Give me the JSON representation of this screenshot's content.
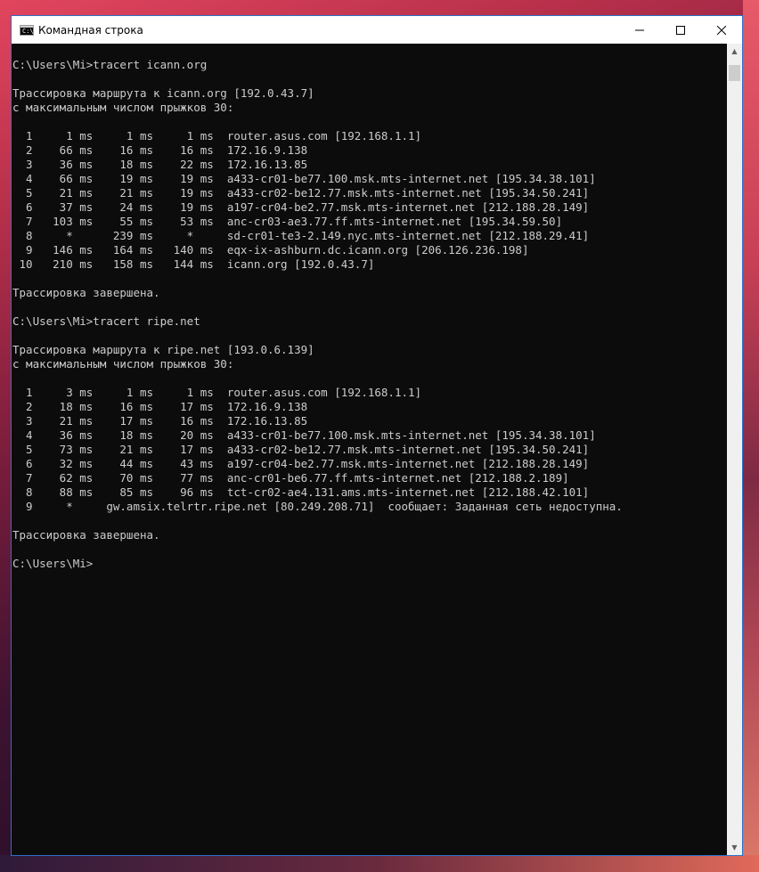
{
  "window": {
    "title": "Командная строка",
    "app_icon_glyph": "C:\\",
    "controls": {
      "minimize_icon": "minimize-icon",
      "maximize_icon": "maximize-icon",
      "close_icon": "close-icon"
    }
  },
  "terminal": {
    "lines": [
      "",
      "C:\\Users\\Mi>tracert icann.org",
      "",
      "Трассировка маршрута к icann.org [192.0.43.7]",
      "с максимальным числом прыжков 30:",
      "",
      "  1     1 ms     1 ms     1 ms  router.asus.com [192.168.1.1]",
      "  2    66 ms    16 ms    16 ms  172.16.9.138",
      "  3    36 ms    18 ms    22 ms  172.16.13.85",
      "  4    66 ms    19 ms    19 ms  a433-cr01-be77.100.msk.mts-internet.net [195.34.38.101]",
      "  5    21 ms    21 ms    19 ms  a433-cr02-be12.77.msk.mts-internet.net [195.34.50.241]",
      "  6    37 ms    24 ms    19 ms  a197-cr04-be2.77.msk.mts-internet.net [212.188.28.149]",
      "  7   103 ms    55 ms    53 ms  anc-cr03-ae3.77.ff.mts-internet.net [195.34.59.50]",
      "  8     *      239 ms     *     sd-cr01-te3-2.149.nyc.mts-internet.net [212.188.29.41]",
      "  9   146 ms   164 ms   140 ms  eqx-ix-ashburn.dc.icann.org [206.126.236.198]",
      " 10   210 ms   158 ms   144 ms  icann.org [192.0.43.7]",
      "",
      "Трассировка завершена.",
      "",
      "C:\\Users\\Mi>tracert ripe.net",
      "",
      "Трассировка маршрута к ripe.net [193.0.6.139]",
      "с максимальным числом прыжков 30:",
      "",
      "  1     3 ms     1 ms     1 ms  router.asus.com [192.168.1.1]",
      "  2    18 ms    16 ms    17 ms  172.16.9.138",
      "  3    21 ms    17 ms    16 ms  172.16.13.85",
      "  4    36 ms    18 ms    20 ms  a433-cr01-be77.100.msk.mts-internet.net [195.34.38.101]",
      "  5    73 ms    21 ms    17 ms  a433-cr02-be12.77.msk.mts-internet.net [195.34.50.241]",
      "  6    32 ms    44 ms    43 ms  a197-cr04-be2.77.msk.mts-internet.net [212.188.28.149]",
      "  7    62 ms    70 ms    77 ms  anc-cr01-be6.77.ff.mts-internet.net [212.188.2.189]",
      "  8    88 ms    85 ms    96 ms  tct-cr02-ae4.131.ams.mts-internet.net [212.188.42.101]",
      "  9     *     gw.amsix.telrtr.ripe.net [80.249.208.71]  сообщает: Заданная сеть недоступна.",
      "",
      "Трассировка завершена.",
      "",
      "C:\\Users\\Mi>"
    ]
  },
  "colors": {
    "terminal_bg": "#0c0c0c",
    "terminal_fg": "#cccccc",
    "window_border": "#2b72c9"
  }
}
